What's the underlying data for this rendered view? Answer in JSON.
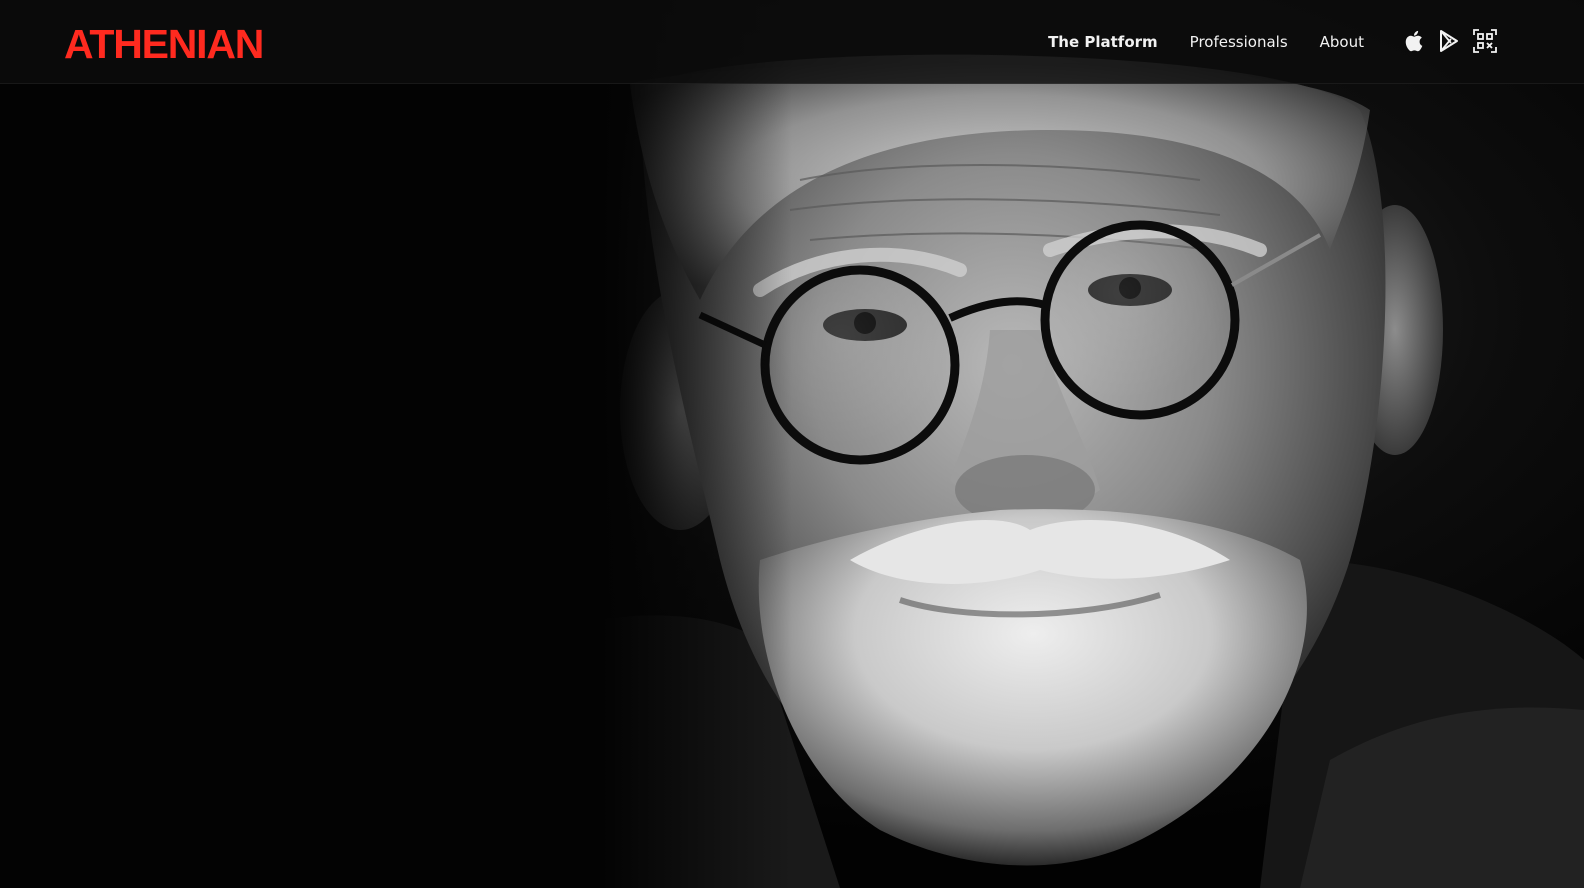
{
  "brand": {
    "name": "ATHENIAN",
    "color": "#ff2a1f"
  },
  "nav": {
    "links": [
      {
        "label": "The Platform",
        "active": true
      },
      {
        "label": "Professionals",
        "active": false
      },
      {
        "label": "About",
        "active": false
      }
    ],
    "icons": [
      "apple-icon",
      "google-play-icon",
      "qr-code-icon"
    ]
  },
  "hero": {
    "image": "black-and-white portrait photo"
  }
}
